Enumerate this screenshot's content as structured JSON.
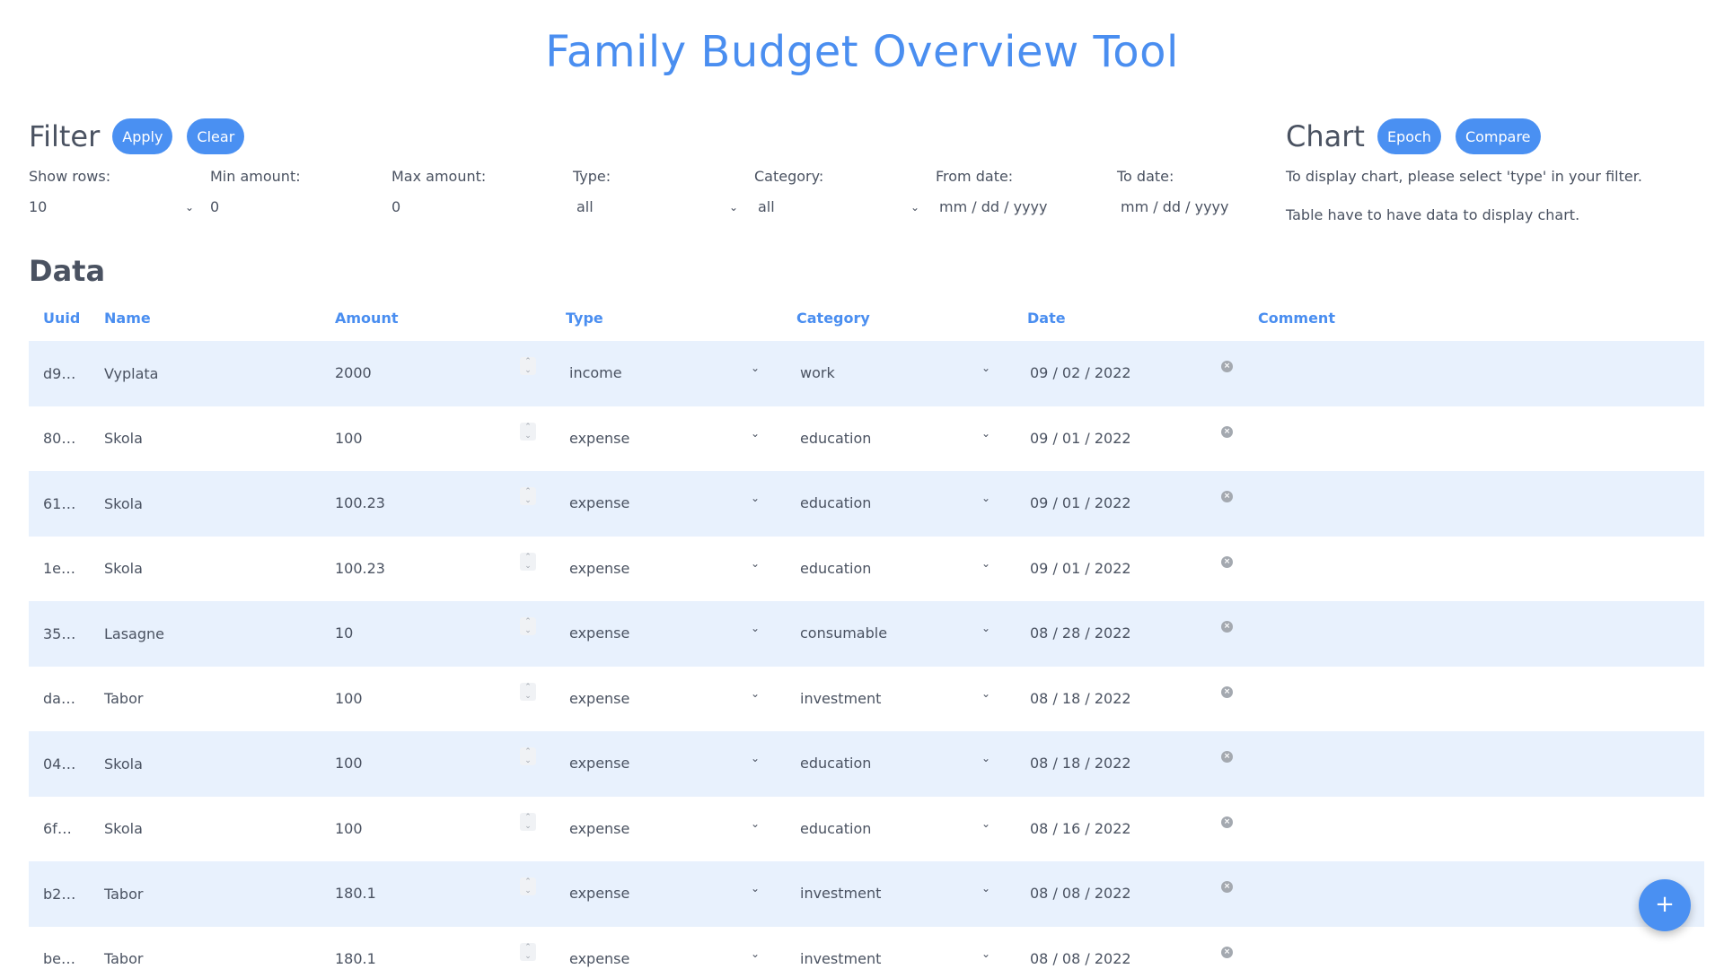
{
  "app": {
    "title": "Family Budget Overview Tool"
  },
  "filter": {
    "title": "Filter",
    "apply_label": "Apply",
    "clear_label": "Clear",
    "fields": {
      "show_rows": {
        "label": "Show rows:",
        "value": "10"
      },
      "min_amount": {
        "label": "Min amount:",
        "value": "0"
      },
      "max_amount": {
        "label": "Max amount:",
        "value": "0"
      },
      "type": {
        "label": "Type:",
        "value": "all"
      },
      "category": {
        "label": "Category:",
        "value": "all"
      },
      "from_date": {
        "label": "From date:",
        "placeholder": "mm / dd / yyyy"
      },
      "to_date": {
        "label": "To date:",
        "placeholder": "mm / dd / yyyy"
      }
    }
  },
  "chart": {
    "title": "Chart",
    "epoch_label": "Epoch",
    "compare_label": "Compare",
    "note_1": "To display chart, please select 'type' in your filter.",
    "note_2": "Table have to have data to display chart."
  },
  "data": {
    "title": "Data",
    "columns": {
      "uuid": "Uuid",
      "name": "Name",
      "amount": "Amount",
      "type": "Type",
      "category": "Category",
      "date": "Date",
      "comment": "Comment"
    },
    "rows": [
      {
        "uuid": "d9…",
        "name": "Vyplata",
        "amount": "2000",
        "type": "income",
        "category": "work",
        "date": "09 / 02 / 2022",
        "comment": ""
      },
      {
        "uuid": "80…",
        "name": "Skola",
        "amount": "100",
        "type": "expense",
        "category": "education",
        "date": "09 / 01 / 2022",
        "comment": ""
      },
      {
        "uuid": "61…",
        "name": "Skola",
        "amount": "100.23",
        "type": "expense",
        "category": "education",
        "date": "09 / 01 / 2022",
        "comment": ""
      },
      {
        "uuid": "1e…",
        "name": "Skola",
        "amount": "100.23",
        "type": "expense",
        "category": "education",
        "date": "09 / 01 / 2022",
        "comment": ""
      },
      {
        "uuid": "35…",
        "name": "Lasagne",
        "amount": "10",
        "type": "expense",
        "category": "consumable",
        "date": "08 / 28 / 2022",
        "comment": ""
      },
      {
        "uuid": "da…",
        "name": "Tabor",
        "amount": "100",
        "type": "expense",
        "category": "investment",
        "date": "08 / 18 / 2022",
        "comment": ""
      },
      {
        "uuid": "04…",
        "name": "Skola",
        "amount": "100",
        "type": "expense",
        "category": "education",
        "date": "08 / 18 / 2022",
        "comment": ""
      },
      {
        "uuid": "6f…",
        "name": "Skola",
        "amount": "100",
        "type": "expense",
        "category": "education",
        "date": "08 / 16 / 2022",
        "comment": ""
      },
      {
        "uuid": "b2…",
        "name": "Tabor",
        "amount": "180.1",
        "type": "expense",
        "category": "investment",
        "date": "08 / 08 / 2022",
        "comment": ""
      },
      {
        "uuid": "be…",
        "name": "Tabor",
        "amount": "180.1",
        "type": "expense",
        "category": "investment",
        "date": "08 / 08 / 2022",
        "comment": ""
      }
    ]
  },
  "fab": {
    "label": "+"
  },
  "icons": {
    "chevron": "chevron-down-icon",
    "spinner": "number-spinner-icon",
    "clear": "clear-x-icon"
  },
  "colors": {
    "accent": "#4a90f2",
    "heading": "#4a8ef0",
    "stripe": "#e8f1fd",
    "text": "#4a5261"
  }
}
